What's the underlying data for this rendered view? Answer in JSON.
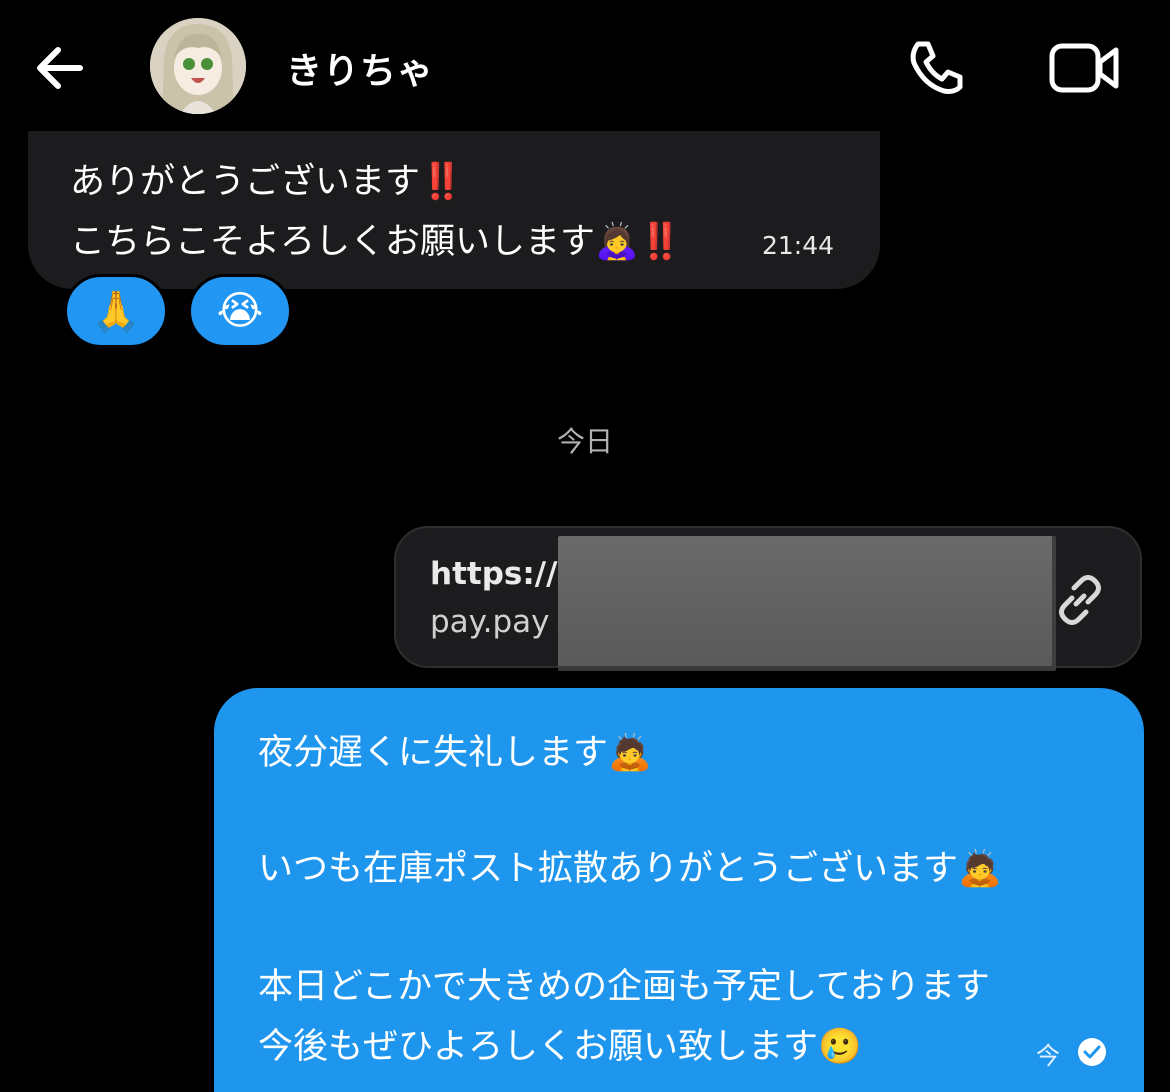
{
  "header": {
    "contact_name": "きりちゃ",
    "back_icon": "arrow-left-icon",
    "call_icon": "phone-icon",
    "video_icon": "video-camera-icon"
  },
  "incoming_message": {
    "line1": "ありがとうございます‼️",
    "line2": "こちらこそよろしくお願いします🙇‍♀️‼️",
    "time": "21:44",
    "reactions": [
      "🙏",
      "😭"
    ]
  },
  "date_divider": "今日",
  "link_message": {
    "url_line1": "https://",
    "url_line2": "pay.pay",
    "link_icon": "link-icon"
  },
  "outgoing_message": {
    "line1": "夜分遅くに失礼します🙇",
    "line2": "いつも在庫ポスト拡散ありがとうございます🙇",
    "line3": "本日どこかで大きめの企画も予定しております",
    "line4": "今後もぜひよろしくお願い致します🥲",
    "status_time": "今",
    "seen_icon": "check-circle-icon"
  },
  "colors": {
    "background": "#000000",
    "incoming_bubble": "#1c1c1e",
    "outgoing_bubble": "#1f96ee"
  }
}
